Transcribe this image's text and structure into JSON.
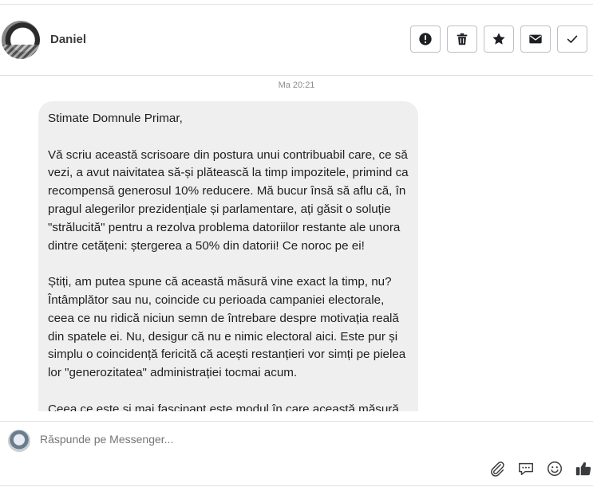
{
  "header": {
    "contact_name": "Daniel",
    "actions": [
      {
        "icon": "alert-icon",
        "label": "report"
      },
      {
        "icon": "trash-icon",
        "label": "delete"
      },
      {
        "icon": "star-icon",
        "label": "star"
      },
      {
        "icon": "envelope-icon",
        "label": "mark unread"
      },
      {
        "icon": "checkmark-icon",
        "label": "done"
      }
    ]
  },
  "thread": {
    "timestamp": "Ma 20:21",
    "message": {
      "paragraphs": [
        "Stimate Domnule Primar,",
        "Vă scriu această scrisoare din postura unui contribuabil care, ce să vezi, a avut naivitatea să-și plătească la timp impozitele, primind ca recompensă generosul 10% reducere. Mă bucur însă să aflu că, în pragul alegerilor prezidențiale și parlamentare, ați găsit o soluție \"strălucită\" pentru a rezolva problema datoriilor restante ale unora dintre cetățeni: ștergerea a 50% din datorii! Ce noroc pe ei!",
        "Știți, am putea spune că această măsură vine exact la timp, nu? Întâmplător sau nu, coincide cu perioada campaniei electorale, ceea ce nu ridică  niciun semn de întrebare despre motivația reală din spatele ei. Nu, desigur că nu e nimic electoral aici. Este pur și simplu o coincidență fericită că acești restanțieri vor simți pe pielea lor \"generozitatea\" administrației tocmai acum.",
        "Ceea ce este și mai fascinant este modul în care această măsură"
      ]
    }
  },
  "composer": {
    "placeholder": "Răspunde pe Messenger...",
    "icons": [
      "paperclip-icon",
      "speech-bubble-icon",
      "emoji-icon",
      "thumbs-up-icon"
    ]
  },
  "colors": {
    "bubble_bg": "#efefef",
    "border": "#dddfe2",
    "text": "#1c1e21",
    "muted": "#8a8d91"
  }
}
